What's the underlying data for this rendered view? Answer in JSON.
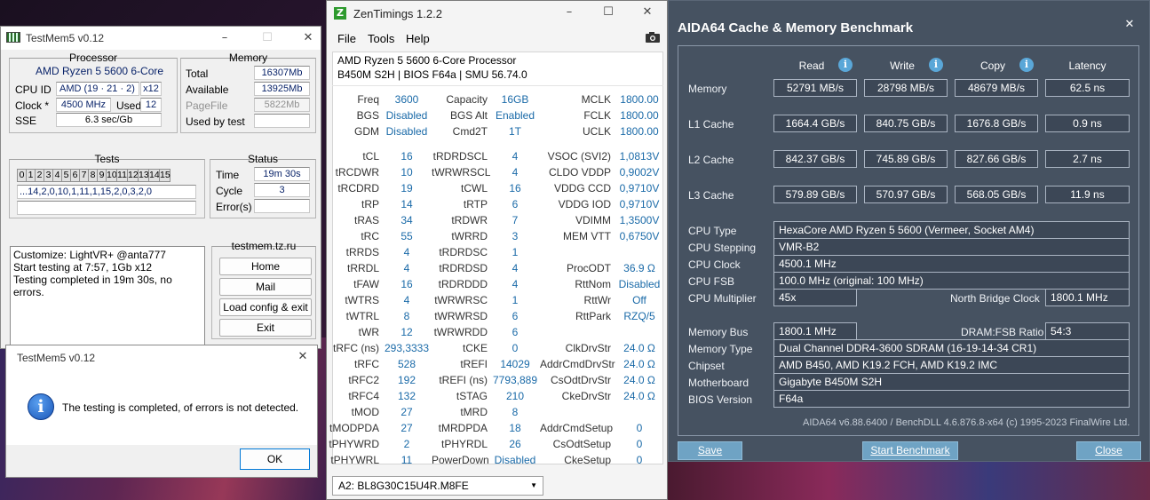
{
  "testmem": {
    "title": "TestMem5 v0.12",
    "processor_group": "Processor",
    "memory_group": "Memory",
    "cpu_name": "AMD Ryzen 5 5600 6-Core",
    "cpu_id_label": "CPU ID",
    "cpu_id_value": "AMD  (19 · 21 · 2)",
    "cpu_threads": "x12",
    "clock_label": "Clock *",
    "clock_value": "4500 MHz",
    "used_label": "Used",
    "used_value": "12",
    "sse_label": "SSE",
    "sse_value": "6.3 sec/Gb",
    "total_label": "Total",
    "total_value": "16307Mb",
    "available_label": "Available",
    "available_value": "13925Mb",
    "pagefile_label": "PageFile",
    "pagefile_value": "5822Mb",
    "used_by_test_label": "Used by test",
    "used_by_test_value": "",
    "tests_group": "Tests",
    "status_group": "Status",
    "tests": [
      "0",
      "1",
      "2",
      "3",
      "4",
      "5",
      "6",
      "7",
      "8",
      "9",
      "10",
      "11",
      "12",
      "13",
      "14",
      "15"
    ],
    "test_sequence": "...14,2,0,10,1,11,1,15,2,0,3,2,0",
    "time_label": "Time",
    "time_value": "19m 30s",
    "cycle_label": "Cycle",
    "cycle_value": "3",
    "errors_label": "Error(s)",
    "errors_value": "",
    "log_lines": [
      "Customize: LightVR+ @anta777",
      "Start testing at 7:57, 1Gb x12",
      "Testing completed in 19m 30s, no errors."
    ],
    "site_label": "testmem.tz.ru",
    "buttons": {
      "home": "Home",
      "mail": "Mail",
      "load": "Load config & exit",
      "exit": "Exit"
    }
  },
  "dialog": {
    "title": "TestMem5 v0.12",
    "message": "The testing is completed, of errors is not detected.",
    "ok": "OK"
  },
  "zen": {
    "title": "ZenTimings 1.2.2",
    "menu": [
      "File",
      "Tools",
      "Help"
    ],
    "cpu": "AMD Ryzen 5 5600 6-Core Processor",
    "board": "B450M S2H | BIOS F64a | SMU 56.74.0",
    "rows": [
      [
        "Freq",
        "3600",
        "Capacity",
        "16GB",
        "MCLK",
        "1800.00"
      ],
      [
        "BGS",
        "Disabled",
        "BGS Alt",
        "Enabled",
        "FCLK",
        "1800.00"
      ],
      [
        "GDM",
        "Disabled",
        "Cmd2T",
        "1T",
        "UCLK",
        "1800.00"
      ],
      [
        "",
        "",
        "",
        "",
        "",
        ""
      ],
      [
        "tCL",
        "16",
        "tRDRDSCL",
        "4",
        "VSOC (SVI2)",
        "1,0813V"
      ],
      [
        "tRCDWR",
        "10",
        "tWRWRSCL",
        "4",
        "CLDO VDDP",
        "0,9002V"
      ],
      [
        "tRCDRD",
        "19",
        "tCWL",
        "16",
        "VDDG CCD",
        "0,9710V"
      ],
      [
        "tRP",
        "14",
        "tRTP",
        "6",
        "VDDG IOD",
        "0,9710V"
      ],
      [
        "tRAS",
        "34",
        "tRDWR",
        "7",
        "VDIMM",
        "1,3500V"
      ],
      [
        "tRC",
        "55",
        "tWRRD",
        "3",
        "MEM VTT",
        "0,6750V"
      ],
      [
        "tRRDS",
        "4",
        "tRDRDSC",
        "1",
        "",
        ""
      ],
      [
        "tRRDL",
        "4",
        "tRDRDSD",
        "4",
        "ProcODT",
        "36.9 Ω"
      ],
      [
        "tFAW",
        "16",
        "tRDRDDD",
        "4",
        "RttNom",
        "Disabled"
      ],
      [
        "tWTRS",
        "4",
        "tWRWRSC",
        "1",
        "RttWr",
        "Off"
      ],
      [
        "tWTRL",
        "8",
        "tWRWRSD",
        "6",
        "RttPark",
        "RZQ/5"
      ],
      [
        "tWR",
        "12",
        "tWRWRDD",
        "6",
        "",
        ""
      ],
      [
        "tRFC (ns)",
        "293,3333",
        "tCKE",
        "0",
        "ClkDrvStr",
        "24.0 Ω"
      ],
      [
        "tRFC",
        "528",
        "tREFI",
        "14029",
        "AddrCmdDrvStr",
        "24.0 Ω"
      ],
      [
        "tRFC2",
        "192",
        "tREFI (ns)",
        "7793,889",
        "CsOdtDrvStr",
        "24.0 Ω"
      ],
      [
        "tRFC4",
        "132",
        "tSTAG",
        "210",
        "CkeDrvStr",
        "24.0 Ω"
      ],
      [
        "tMOD",
        "27",
        "tMRD",
        "8",
        "",
        ""
      ],
      [
        "tMODPDA",
        "27",
        "tMRDPDA",
        "18",
        "AddrCmdSetup",
        "0"
      ],
      [
        "tPHYWRD",
        "2",
        "tPHYRDL",
        "26",
        "CsOdtSetup",
        "0"
      ],
      [
        "tPHYWRL",
        "11",
        "PowerDown",
        "Disabled",
        "CkeSetup",
        "0"
      ]
    ],
    "dimm": "A2: BL8G30C15U4R.M8FE"
  },
  "aida": {
    "title": "AIDA64 Cache & Memory Benchmark",
    "headers": [
      "Read",
      "Write",
      "Copy",
      "Latency"
    ],
    "bench": [
      {
        "label": "Memory",
        "values": [
          "52791 MB/s",
          "28798 MB/s",
          "48679 MB/s",
          "62.5 ns"
        ]
      },
      {
        "label": "L1 Cache",
        "values": [
          "1664.4 GB/s",
          "840.75 GB/s",
          "1676.8 GB/s",
          "0.9 ns"
        ]
      },
      {
        "label": "L2 Cache",
        "values": [
          "842.37 GB/s",
          "745.89 GB/s",
          "827.66 GB/s",
          "2.7 ns"
        ]
      },
      {
        "label": "L3 Cache",
        "values": [
          "579.89 GB/s",
          "570.97 GB/s",
          "568.05 GB/s",
          "11.9 ns"
        ]
      }
    ],
    "cpu_type_label": "CPU Type",
    "cpu_type": "HexaCore AMD Ryzen 5 5600  (Vermeer, Socket AM4)",
    "cpu_stepping_label": "CPU Stepping",
    "cpu_stepping": "VMR-B2",
    "cpu_clock_label": "CPU Clock",
    "cpu_clock": "4500.1 MHz",
    "cpu_fsb_label": "CPU FSB",
    "cpu_fsb": "100.0 MHz  (original: 100 MHz)",
    "cpu_mult_label": "CPU Multiplier",
    "cpu_mult": "45x",
    "nb_clock_label": "North Bridge Clock",
    "nb_clock": "1800.1 MHz",
    "mem_bus_label": "Memory Bus",
    "mem_bus": "1800.1 MHz",
    "dram_ratio_label": "DRAM:FSB Ratio",
    "dram_ratio": "54:3",
    "mem_type_label": "Memory Type",
    "mem_type": "Dual Channel DDR4-3600 SDRAM  (16-19-14-34 CR1)",
    "chipset_label": "Chipset",
    "chipset": "AMD B450, AMD K19.2 FCH, AMD K19.2 IMC",
    "mobo_label": "Motherboard",
    "mobo": "Gigabyte B450M S2H",
    "bios_label": "BIOS Version",
    "bios": "F64a",
    "footer": "AIDA64 v6.88.6400 / BenchDLL 4.6.876.8-x64  (c) 1995-2023 FinalWire Ltd.",
    "save": "Save",
    "start": "Start Benchmark",
    "close": "Close"
  }
}
